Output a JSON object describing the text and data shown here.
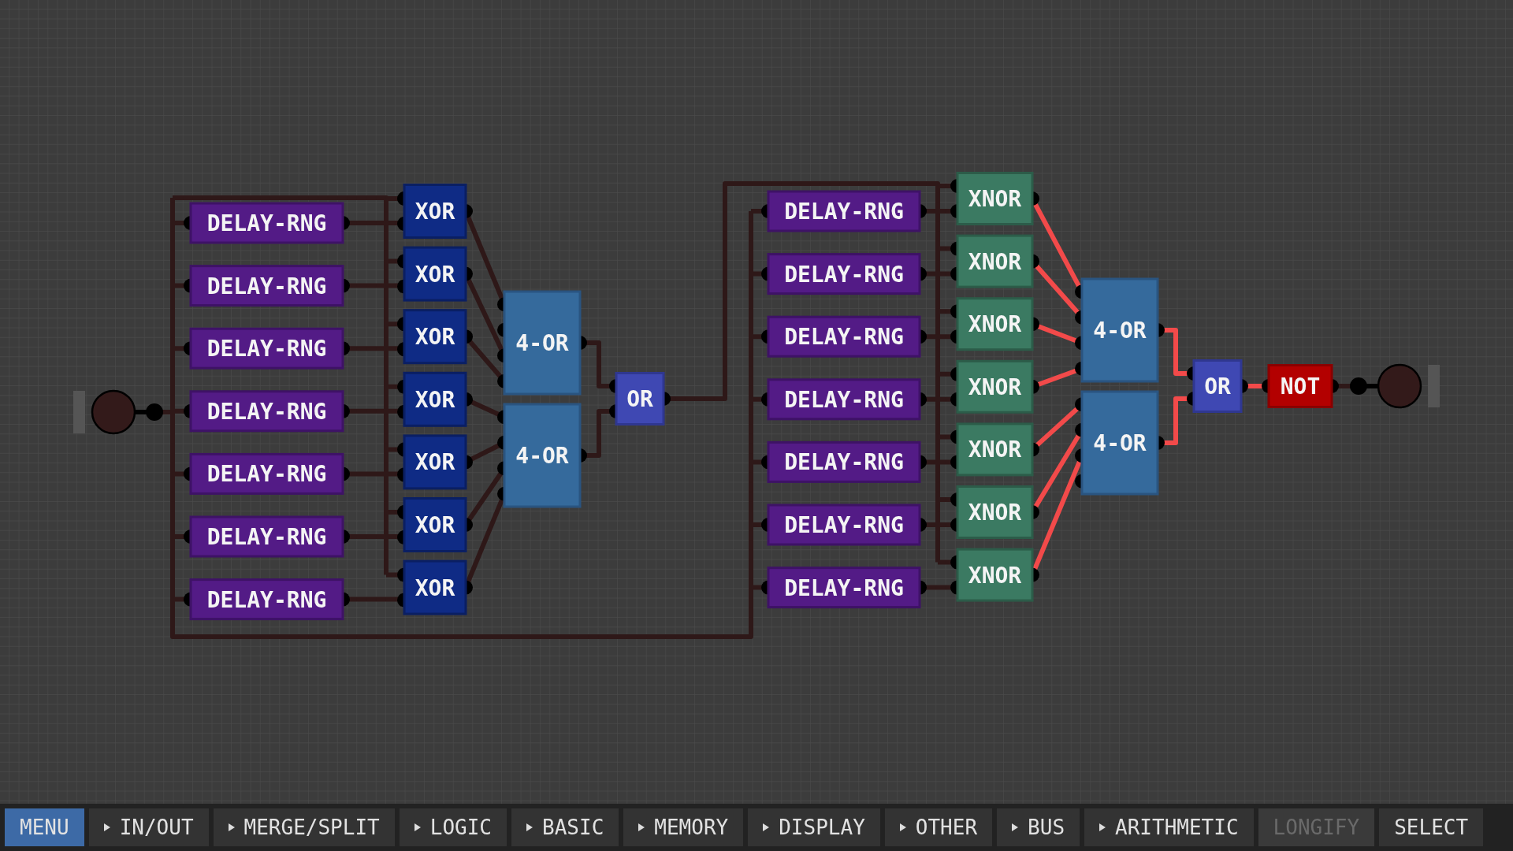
{
  "input": {
    "on": false
  },
  "chips": [
    {
      "kind": "delay",
      "label": "DELAY-RNG",
      "output_on": false
    },
    {
      "kind": "delay",
      "label": "DELAY-RNG",
      "output_on": false
    },
    {
      "kind": "delay",
      "label": "DELAY-RNG",
      "output_on": false
    },
    {
      "kind": "delay",
      "label": "DELAY-RNG",
      "output_on": false
    },
    {
      "kind": "delay",
      "label": "DELAY-RNG",
      "output_on": false
    },
    {
      "kind": "delay",
      "label": "DELAY-RNG",
      "output_on": false
    },
    {
      "kind": "delay",
      "label": "DELAY-RNG",
      "output_on": false
    },
    {
      "kind": "xor",
      "label": "XOR",
      "output_on": false
    },
    {
      "kind": "xor",
      "label": "XOR",
      "output_on": false
    },
    {
      "kind": "xor",
      "label": "XOR",
      "output_on": false
    },
    {
      "kind": "xor",
      "label": "XOR",
      "output_on": false
    },
    {
      "kind": "xor",
      "label": "XOR",
      "output_on": false
    },
    {
      "kind": "xor",
      "label": "XOR",
      "output_on": false
    },
    {
      "kind": "xor",
      "label": "XOR",
      "output_on": false
    },
    {
      "kind": "or4",
      "label": "4-OR",
      "output_on": false
    },
    {
      "kind": "or4",
      "label": "4-OR",
      "output_on": false
    },
    {
      "kind": "or",
      "label": "OR",
      "output_on": false
    },
    {
      "kind": "delay",
      "label": "DELAY-RNG",
      "output_on": false
    },
    {
      "kind": "delay",
      "label": "DELAY-RNG",
      "output_on": false
    },
    {
      "kind": "delay",
      "label": "DELAY-RNG",
      "output_on": false
    },
    {
      "kind": "delay",
      "label": "DELAY-RNG",
      "output_on": false
    },
    {
      "kind": "delay",
      "label": "DELAY-RNG",
      "output_on": false
    },
    {
      "kind": "delay",
      "label": "DELAY-RNG",
      "output_on": false
    },
    {
      "kind": "delay",
      "label": "DELAY-RNG",
      "output_on": false
    },
    {
      "kind": "xnor",
      "label": "XNOR",
      "output_on": true
    },
    {
      "kind": "xnor",
      "label": "XNOR",
      "output_on": true
    },
    {
      "kind": "xnor",
      "label": "XNOR",
      "output_on": true
    },
    {
      "kind": "xnor",
      "label": "XNOR",
      "output_on": true
    },
    {
      "kind": "xnor",
      "label": "XNOR",
      "output_on": true
    },
    {
      "kind": "xnor",
      "label": "XNOR",
      "output_on": true
    },
    {
      "kind": "xnor",
      "label": "XNOR",
      "output_on": true
    },
    {
      "kind": "or4",
      "label": "4-OR",
      "output_on": true
    },
    {
      "kind": "or4",
      "label": "4-OR",
      "output_on": true
    },
    {
      "kind": "or",
      "label": "OR",
      "output_on": true
    },
    {
      "kind": "not",
      "label": "NOT",
      "output_on": false
    }
  ],
  "output": {
    "on": false
  },
  "toolbar": [
    {
      "label": "MENU",
      "selected": true,
      "submenu": false,
      "disabled": false
    },
    {
      "label": "IN/OUT",
      "selected": false,
      "submenu": true,
      "disabled": false
    },
    {
      "label": "MERGE/SPLIT",
      "selected": false,
      "submenu": true,
      "disabled": false
    },
    {
      "label": "LOGIC",
      "selected": false,
      "submenu": true,
      "disabled": false
    },
    {
      "label": "BASIC",
      "selected": false,
      "submenu": true,
      "disabled": false
    },
    {
      "label": "MEMORY",
      "selected": false,
      "submenu": true,
      "disabled": false
    },
    {
      "label": "DISPLAY",
      "selected": false,
      "submenu": true,
      "disabled": false
    },
    {
      "label": "OTHER",
      "selected": false,
      "submenu": true,
      "disabled": false
    },
    {
      "label": "BUS",
      "selected": false,
      "submenu": true,
      "disabled": false
    },
    {
      "label": "ARITHMETIC",
      "selected": false,
      "submenu": true,
      "disabled": false
    },
    {
      "label": "LONGIFY",
      "selected": false,
      "submenu": false,
      "disabled": true
    },
    {
      "label": "SELECT",
      "selected": false,
      "submenu": false,
      "disabled": false
    }
  ]
}
